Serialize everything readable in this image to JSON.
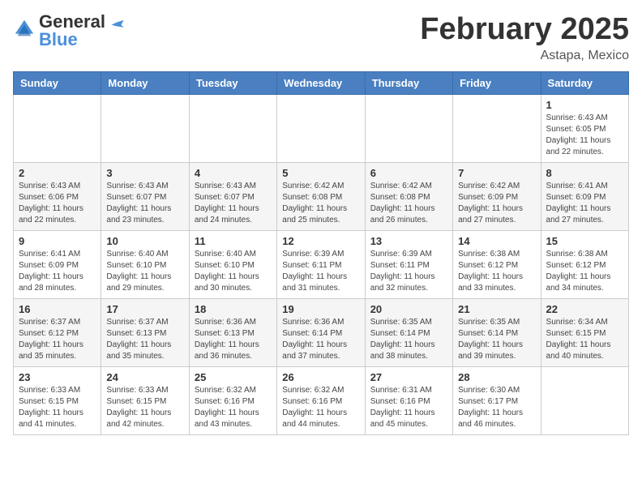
{
  "header": {
    "logo": {
      "general": "General",
      "blue": "Blue"
    },
    "title": "February 2025",
    "location": "Astapa, Mexico"
  },
  "days_of_week": [
    "Sunday",
    "Monday",
    "Tuesday",
    "Wednesday",
    "Thursday",
    "Friday",
    "Saturday"
  ],
  "weeks": [
    [
      {
        "day": "",
        "info": ""
      },
      {
        "day": "",
        "info": ""
      },
      {
        "day": "",
        "info": ""
      },
      {
        "day": "",
        "info": ""
      },
      {
        "day": "",
        "info": ""
      },
      {
        "day": "",
        "info": ""
      },
      {
        "day": "1",
        "info": "Sunrise: 6:43 AM\nSunset: 6:05 PM\nDaylight: 11 hours and 22 minutes."
      }
    ],
    [
      {
        "day": "2",
        "info": "Sunrise: 6:43 AM\nSunset: 6:06 PM\nDaylight: 11 hours and 22 minutes."
      },
      {
        "day": "3",
        "info": "Sunrise: 6:43 AM\nSunset: 6:07 PM\nDaylight: 11 hours and 23 minutes."
      },
      {
        "day": "4",
        "info": "Sunrise: 6:43 AM\nSunset: 6:07 PM\nDaylight: 11 hours and 24 minutes."
      },
      {
        "day": "5",
        "info": "Sunrise: 6:42 AM\nSunset: 6:08 PM\nDaylight: 11 hours and 25 minutes."
      },
      {
        "day": "6",
        "info": "Sunrise: 6:42 AM\nSunset: 6:08 PM\nDaylight: 11 hours and 26 minutes."
      },
      {
        "day": "7",
        "info": "Sunrise: 6:42 AM\nSunset: 6:09 PM\nDaylight: 11 hours and 27 minutes."
      },
      {
        "day": "8",
        "info": "Sunrise: 6:41 AM\nSunset: 6:09 PM\nDaylight: 11 hours and 27 minutes."
      }
    ],
    [
      {
        "day": "9",
        "info": "Sunrise: 6:41 AM\nSunset: 6:09 PM\nDaylight: 11 hours and 28 minutes."
      },
      {
        "day": "10",
        "info": "Sunrise: 6:40 AM\nSunset: 6:10 PM\nDaylight: 11 hours and 29 minutes."
      },
      {
        "day": "11",
        "info": "Sunrise: 6:40 AM\nSunset: 6:10 PM\nDaylight: 11 hours and 30 minutes."
      },
      {
        "day": "12",
        "info": "Sunrise: 6:39 AM\nSunset: 6:11 PM\nDaylight: 11 hours and 31 minutes."
      },
      {
        "day": "13",
        "info": "Sunrise: 6:39 AM\nSunset: 6:11 PM\nDaylight: 11 hours and 32 minutes."
      },
      {
        "day": "14",
        "info": "Sunrise: 6:38 AM\nSunset: 6:12 PM\nDaylight: 11 hours and 33 minutes."
      },
      {
        "day": "15",
        "info": "Sunrise: 6:38 AM\nSunset: 6:12 PM\nDaylight: 11 hours and 34 minutes."
      }
    ],
    [
      {
        "day": "16",
        "info": "Sunrise: 6:37 AM\nSunset: 6:12 PM\nDaylight: 11 hours and 35 minutes."
      },
      {
        "day": "17",
        "info": "Sunrise: 6:37 AM\nSunset: 6:13 PM\nDaylight: 11 hours and 35 minutes."
      },
      {
        "day": "18",
        "info": "Sunrise: 6:36 AM\nSunset: 6:13 PM\nDaylight: 11 hours and 36 minutes."
      },
      {
        "day": "19",
        "info": "Sunrise: 6:36 AM\nSunset: 6:14 PM\nDaylight: 11 hours and 37 minutes."
      },
      {
        "day": "20",
        "info": "Sunrise: 6:35 AM\nSunset: 6:14 PM\nDaylight: 11 hours and 38 minutes."
      },
      {
        "day": "21",
        "info": "Sunrise: 6:35 AM\nSunset: 6:14 PM\nDaylight: 11 hours and 39 minutes."
      },
      {
        "day": "22",
        "info": "Sunrise: 6:34 AM\nSunset: 6:15 PM\nDaylight: 11 hours and 40 minutes."
      }
    ],
    [
      {
        "day": "23",
        "info": "Sunrise: 6:33 AM\nSunset: 6:15 PM\nDaylight: 11 hours and 41 minutes."
      },
      {
        "day": "24",
        "info": "Sunrise: 6:33 AM\nSunset: 6:15 PM\nDaylight: 11 hours and 42 minutes."
      },
      {
        "day": "25",
        "info": "Sunrise: 6:32 AM\nSunset: 6:16 PM\nDaylight: 11 hours and 43 minutes."
      },
      {
        "day": "26",
        "info": "Sunrise: 6:32 AM\nSunset: 6:16 PM\nDaylight: 11 hours and 44 minutes."
      },
      {
        "day": "27",
        "info": "Sunrise: 6:31 AM\nSunset: 6:16 PM\nDaylight: 11 hours and 45 minutes."
      },
      {
        "day": "28",
        "info": "Sunrise: 6:30 AM\nSunset: 6:17 PM\nDaylight: 11 hours and 46 minutes."
      },
      {
        "day": "",
        "info": ""
      }
    ]
  ]
}
